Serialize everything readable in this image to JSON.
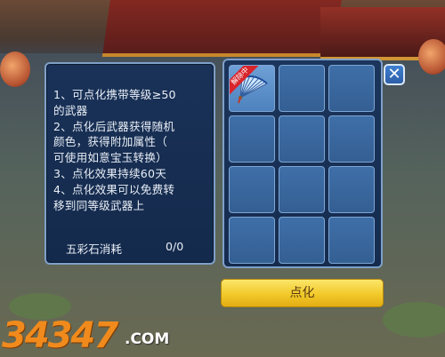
{
  "info_panel": {
    "lines": [
      "1、可点化携带等级≥50",
      "的武器",
      "2、点化后武器获得随机",
      "颜色，获得附加属性（",
      "可使用如意宝玉转换）",
      "3、点化效果持续60天",
      "4、点化效果可以免费转",
      "移到同等级武器上"
    ],
    "cost_label": "五彩石消耗",
    "cost_value": "0/0"
  },
  "inventory": {
    "ribbon_text": "解除中",
    "filled_item_icon": "fan-icon",
    "slots": 12
  },
  "close_icon": "✕",
  "action_button_label": "点化",
  "watermark": {
    "digits": "34347",
    "suffix": ".COM"
  },
  "colors": {
    "panel": "#1a3258",
    "slot": "#3f6fa8",
    "button": "#f2c92a",
    "ribbon": "#d8252b"
  }
}
